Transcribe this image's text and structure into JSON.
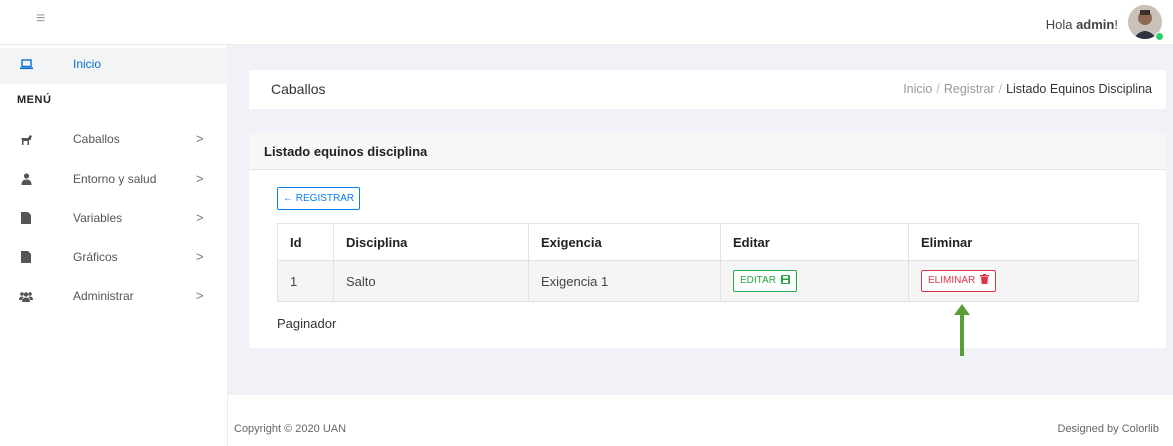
{
  "topbar": {
    "greeting_prefix": "Hola ",
    "greeting_user": "admin",
    "greeting_suffix": "!"
  },
  "sidebar": {
    "home": {
      "label": "Inicio",
      "icon": "laptop-icon"
    },
    "menu_title": "MENÚ",
    "items": [
      {
        "label": "Caballos",
        "icon": "horse-icon"
      },
      {
        "label": "Entorno y salud",
        "icon": "user-icon"
      },
      {
        "label": "Variables",
        "icon": "file-icon"
      },
      {
        "label": "Gráficos",
        "icon": "file-icon"
      },
      {
        "label": "Administrar",
        "icon": "users-icon"
      }
    ],
    "chevron": ">"
  },
  "header": {
    "title": "Caballos",
    "breadcrumb": [
      "Inicio",
      "Registrar",
      "Listado Equinos Disciplina"
    ],
    "separator": "/"
  },
  "card": {
    "title": "Listado equinos disciplina",
    "register_button": "← REGISTRAR",
    "table": {
      "columns": [
        "Id",
        "Disciplina",
        "Exigencia",
        "Editar",
        "Eliminar"
      ],
      "rows": [
        {
          "id": "1",
          "disciplina": "Salto",
          "exigencia": "Exigencia 1",
          "edit_label": "EDITAR",
          "delete_label": "ELIMINAR"
        }
      ]
    },
    "pager": "Paginador"
  },
  "footer": {
    "copyright": "Copyright © 2020 UAN",
    "designed": "Designed by Colorlib"
  },
  "colors": {
    "accent": "#0a7ff0",
    "success": "#28a745",
    "danger": "#dc3545",
    "arrow": "#5a9e3a"
  }
}
